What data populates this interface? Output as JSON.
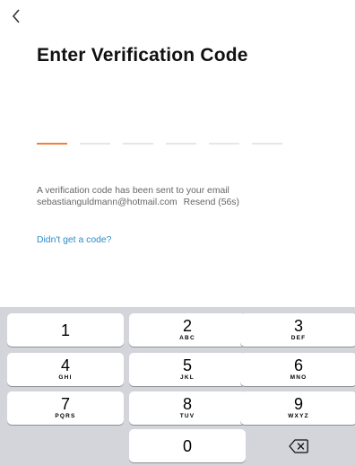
{
  "header": {
    "back_icon": "chevron-left-icon"
  },
  "title": "Enter Verification Code",
  "code": {
    "length": 6,
    "filled": 0
  },
  "info": {
    "line1": "A verification code has been sent to your email",
    "email": "sebastianguldmann@hotmail.com",
    "resend": "Resend (56s)"
  },
  "help_link": "Didn't get a code?",
  "colors": {
    "accent": "#f0813c",
    "link": "#2b8cc5",
    "keyboard_bg": "#d3d5db"
  },
  "keypad": {
    "keys": [
      {
        "digit": "1",
        "letters": ""
      },
      {
        "digit": "2",
        "letters": "ABC"
      },
      {
        "digit": "3",
        "letters": "DEF"
      },
      {
        "digit": "4",
        "letters": "GHI"
      },
      {
        "digit": "5",
        "letters": "JKL"
      },
      {
        "digit": "6",
        "letters": "MNO"
      },
      {
        "digit": "7",
        "letters": "PQRS"
      },
      {
        "digit": "8",
        "letters": "TUV"
      },
      {
        "digit": "9",
        "letters": "WXYZ"
      },
      {
        "digit": "0",
        "letters": ""
      }
    ],
    "delete_icon": "backspace-icon"
  }
}
